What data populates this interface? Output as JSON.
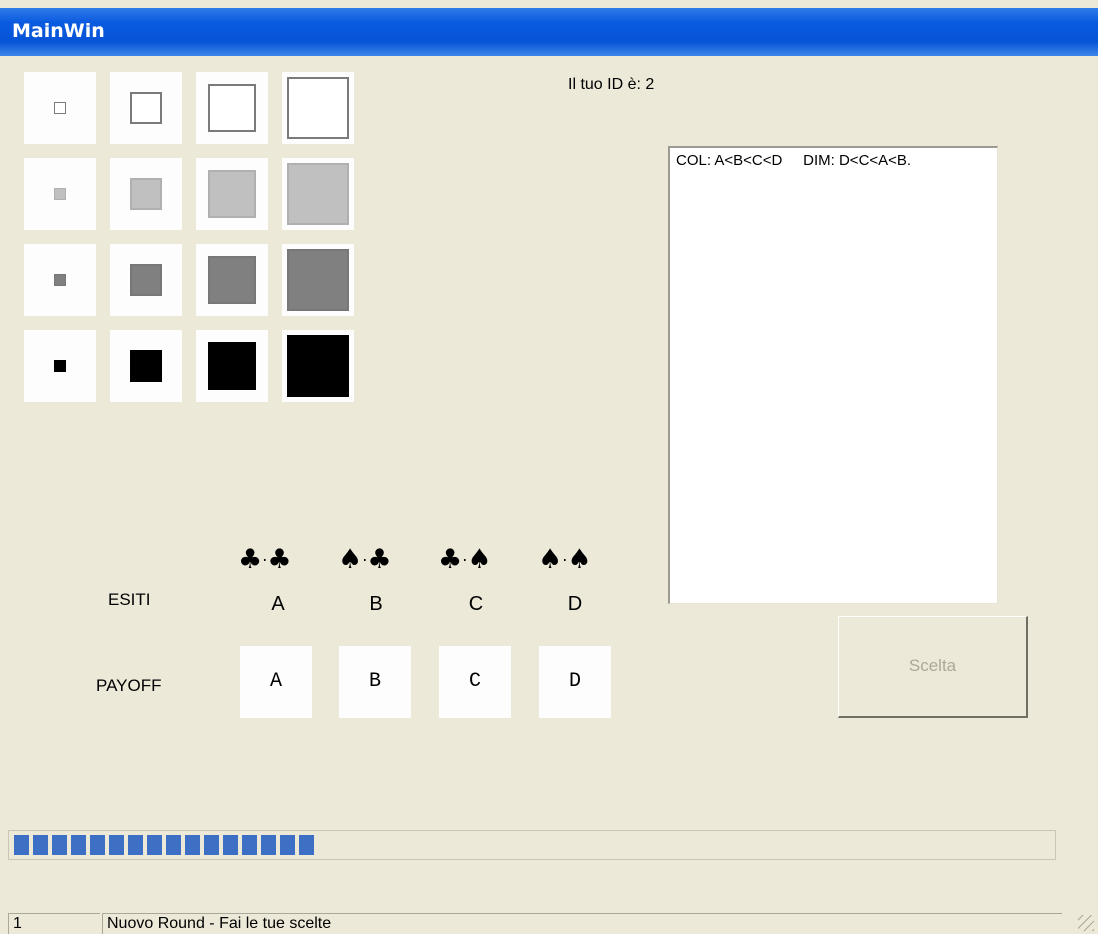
{
  "window": {
    "title": "MainWin"
  },
  "id_label": "Il tuo ID è: 2",
  "outcomes_list": {
    "lines": [
      "COL: A<B<C<D     DIM: D<C<A<B."
    ]
  },
  "symbol_grid": {
    "rows": [
      {
        "fill": "#ffffff",
        "border": "#7a7a7a"
      },
      {
        "fill": "#c0c0c0",
        "border": "#b0b0b0"
      },
      {
        "fill": "#808080",
        "border": "#777777"
      },
      {
        "fill": "#000000",
        "border": "#000000"
      }
    ]
  },
  "outcomes": {
    "label": "ESITI",
    "items": [
      {
        "letter": "A",
        "left_suit": "♣",
        "right_suit": "♣"
      },
      {
        "letter": "B",
        "left_suit": "♠",
        "right_suit": "♣"
      },
      {
        "letter": "C",
        "left_suit": "♣",
        "right_suit": "♠"
      },
      {
        "letter": "D",
        "left_suit": "♠",
        "right_suit": "♠"
      }
    ],
    "separator": "·"
  },
  "payoff": {
    "label": "PAYOFF",
    "values": [
      "A",
      "B",
      "C",
      "D"
    ]
  },
  "choice_button": {
    "label": "Scelta",
    "enabled": false
  },
  "progress": {
    "value_fraction": 0.29,
    "color": "#3d6fc4"
  },
  "status_bar": {
    "round": "1",
    "message": "Nuovo Round - Fai le tue scelte"
  }
}
